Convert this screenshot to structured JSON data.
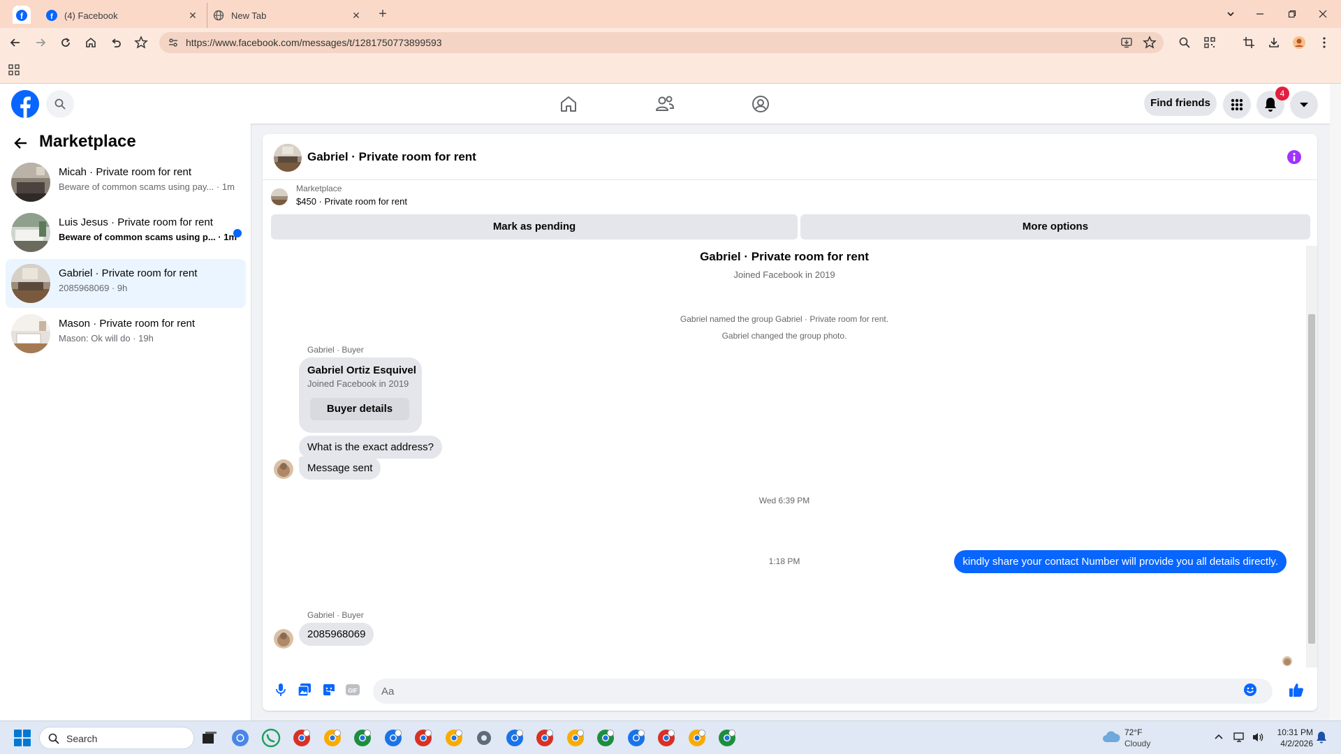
{
  "browser": {
    "tabs": [
      {
        "title": "(4) Facebook"
      },
      {
        "title": "New Tab"
      }
    ],
    "url": "https://www.facebook.com/messages/t/1281750773899593"
  },
  "header": {
    "find_friends_label": "Find friends",
    "notification_count": "4"
  },
  "sidebar": {
    "title": "Marketplace",
    "conversations": [
      {
        "name": "Micah · Private room for rent",
        "preview": "Beware of common scams using pay... · 1m",
        "unread": false,
        "active": false
      },
      {
        "name": "Luis Jesus · Private room for rent",
        "preview": "Beware of common scams using p... · 1m",
        "unread": true,
        "active": false
      },
      {
        "name": "Gabriel · Private room for rent",
        "preview": "2085968069 · 9h",
        "unread": false,
        "active": true
      },
      {
        "name": "Mason · Private room for rent",
        "preview": "Mason: Ok will do · 19h",
        "unread": false,
        "active": false
      }
    ]
  },
  "chat": {
    "title": "Gabriel · Private room for rent",
    "listing": {
      "source": "Marketplace",
      "description": "$450 · Private room for rent"
    },
    "actions": {
      "pending_label": "Mark as pending",
      "more_label": "More options"
    },
    "thread_title": "Gabriel · Private room for rent",
    "thread_joined": "Joined Facebook in 2019",
    "system_messages": [
      "Gabriel named the group Gabriel · Private room for rent.",
      "Gabriel changed the group photo."
    ],
    "sender_label": "Gabriel · Buyer",
    "buyer_card": {
      "name": "Gabriel Ortiz Esquivel",
      "joined": "Joined Facebook in 2019",
      "button_label": "Buyer details"
    },
    "incoming_1": "What is the exact address?",
    "incoming_2": "Message sent",
    "timestamp_1": "Wed 6:39 PM",
    "outgoing_1": "kindly share your contact Number will provide you all details directly.",
    "timestamp_2": "1:18 PM",
    "sender_label_2": "Gabriel · Buyer",
    "incoming_3": "2085968069",
    "composer_placeholder": "Aa"
  },
  "taskbar": {
    "search_label": "Search",
    "weather_temp": "72°F",
    "weather_condition": "Cloudy",
    "time": "10:31 PM",
    "date": "4/2/2026"
  },
  "colors": {
    "facebook_blue": "#0866ff",
    "unread_dot": "#0866ff",
    "info_purple": "#a033ff",
    "notification_red": "#e41e3f"
  }
}
